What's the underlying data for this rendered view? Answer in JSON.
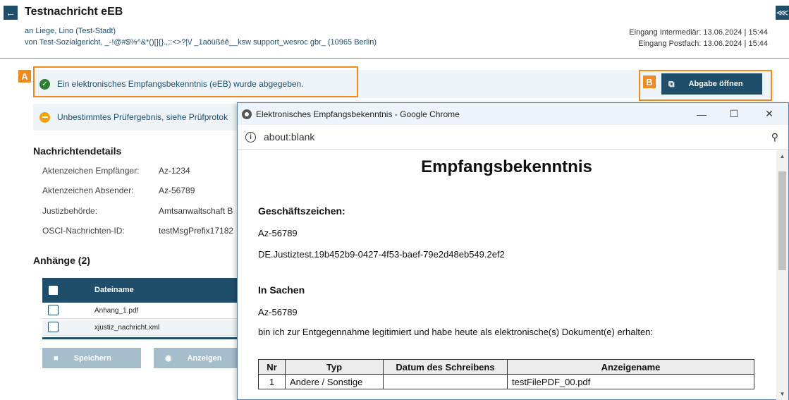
{
  "header": {
    "back_icon": "arrow-left-icon",
    "title": "Testnachricht eEB",
    "to_prefix": "an",
    "to_name": "Liege, Lino (Test-Stadt)",
    "from_prefix": "von",
    "from_name": "Test-Sozialgericht, _-!@#$%^&*()[]{}.,;:<>?|\\/ _1aöüßéê__ksw support_wesroc gbr_ (10965 Berlin)",
    "receipt_intermediary": "Eingang Intermediär: 13.06.2024 | 15:44",
    "receipt_mailbox": "Eingang Postfach: 13.06.2024 | 15:44",
    "share_icon": "share-icon"
  },
  "banners": {
    "ok_text": "Ein elektronisches Empfangsbekenntnis (eEB) wurde abgegeben.",
    "warn_text": "Unbestimmtes Prüfergebnis, siehe Prüfprotok",
    "open_button": "Abgabe öffnen",
    "tag_a": "A",
    "tag_b": "B"
  },
  "details": {
    "heading": "Nachrichtendetails",
    "rows": [
      {
        "label": "Aktenzeichen Empfänger:",
        "value": "Az-1234"
      },
      {
        "label": "Aktenzeichen Absender:",
        "value": "Az-56789"
      },
      {
        "label": "Justizbehörde:",
        "value": "Amtsanwaltschaft B"
      },
      {
        "label": "OSCI-Nachrichten-ID:",
        "value": "testMsgPrefix17182"
      }
    ]
  },
  "attachments": {
    "heading": "Anhänge (2)",
    "column": "Dateiname",
    "files": [
      "Anhang_1.pdf",
      "xjustiz_nachricht.xml"
    ],
    "save_button": "Speichern",
    "view_button": "Anzeigen"
  },
  "popup": {
    "window_title": "Elektronisches Empfangsbekenntnis - Google Chrome",
    "url": "about:blank",
    "doc_title": "Empfangsbekenntnis",
    "section1_heading": "Geschäftszeichen:",
    "section1_line1": "Az-56789",
    "section1_line2": "DE.Justiztest.19b452b9-0427-4f53-baef-79e2d48eb549.2ef2",
    "section2_heading": "In Sachen",
    "section2_line1": "Az-56789",
    "section2_line2": "bin ich zur Entgegennahme legitimiert und habe heute als elektronische(s) Dokument(e) erhalten:",
    "table_headers": [
      "Nr",
      "Typ",
      "Datum des Schreibens",
      "Anzeigename"
    ],
    "table_rows": [
      [
        "1",
        "Andere / Sonstige",
        "",
        "testFilePDF_00.pdf"
      ]
    ]
  }
}
